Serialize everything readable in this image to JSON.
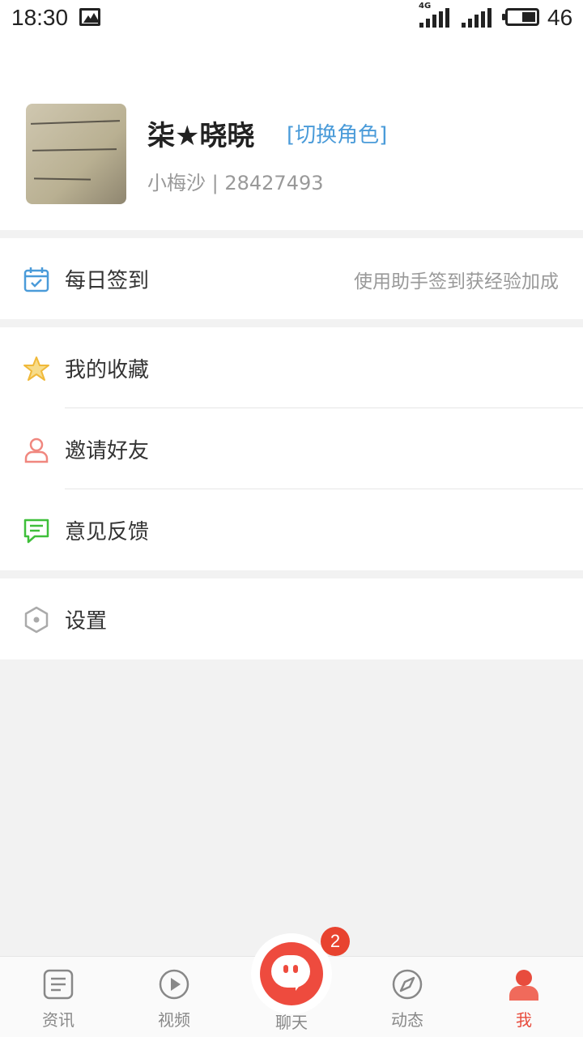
{
  "status_bar": {
    "time": "18:30",
    "network": "4G",
    "battery_text": "46"
  },
  "profile": {
    "name": "柒★晓晓",
    "switch_role": "[切换角色]",
    "subtitle": "小梅沙 | 28427493"
  },
  "menu": {
    "checkin": {
      "label": "每日签到",
      "hint": "使用助手签到获经验加成",
      "icon": "calendar-check-icon"
    },
    "favorites": {
      "label": "我的收藏",
      "icon": "star-icon"
    },
    "invite": {
      "label": "邀请好友",
      "icon": "person-icon"
    },
    "feedback": {
      "label": "意见反馈",
      "icon": "message-icon"
    },
    "settings": {
      "label": "设置",
      "icon": "hexagon-gear-icon"
    }
  },
  "bottom_nav": {
    "tabs": [
      {
        "label": "资讯",
        "icon": "document-icon"
      },
      {
        "label": "视频",
        "icon": "play-circle-icon"
      },
      {
        "label": "聊天",
        "icon": "chat-bubble-icon"
      },
      {
        "label": "动态",
        "icon": "compass-icon"
      },
      {
        "label": "我",
        "icon": "user-icon"
      }
    ],
    "chat_badge": "2"
  },
  "colors": {
    "accent_red": "#e84c3d",
    "link_blue": "#4a9bd9"
  }
}
